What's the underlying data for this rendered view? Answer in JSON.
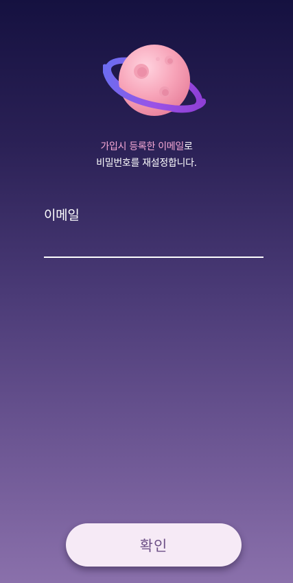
{
  "illustration": {
    "icon": "planet-icon"
  },
  "headline": {
    "accent": "가입시 등록한 이메일",
    "suffix": "로",
    "line2": "비밀번호를 재설정합니다."
  },
  "form": {
    "email_label": "이메일",
    "email_value": "",
    "email_placeholder": ""
  },
  "actions": {
    "confirm_label": "확인"
  },
  "colors": {
    "accent_text": "#f7a9d6",
    "button_bg": "#f6eaf6",
    "button_text": "#6c4f86"
  }
}
